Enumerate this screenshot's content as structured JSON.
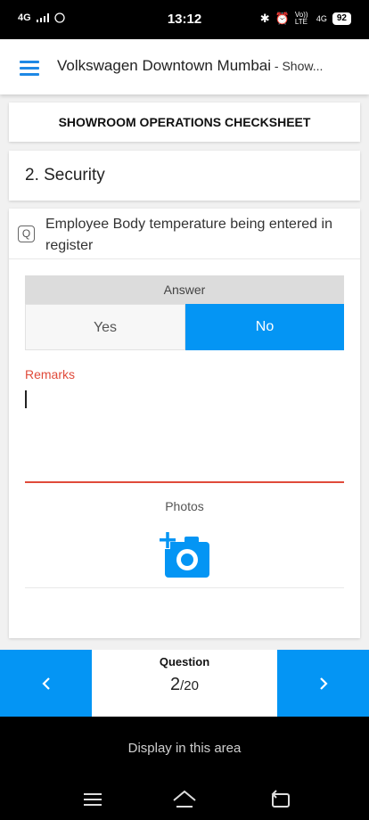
{
  "status_bar": {
    "network": "4G",
    "time": "13:12",
    "right_icons": [
      "bluetooth-icon",
      "alarm-icon",
      "volte-icon",
      "signal-4g-icon"
    ],
    "volte": "Vo)) LTE",
    "net_right": "4G",
    "battery": "92"
  },
  "header": {
    "title": "Volkswagen Downtown Mumbai",
    "subtitle": " - Show...",
    "menu_icon": "hamburger-menu-icon",
    "accent": "#1e88e5"
  },
  "checksheet": {
    "title": "SHOWROOM OPERATIONS CHECKSHEET"
  },
  "section": {
    "title": "2. Security"
  },
  "question": {
    "icon_glyph": "Q",
    "text": "Employee Body temperature being entered in register",
    "answer": {
      "header": "Answer",
      "options": [
        "Yes",
        "No"
      ],
      "selected": "No",
      "selected_color": "#0495f4"
    },
    "remarks": {
      "label": "Remarks",
      "value": "",
      "accent": "#e04a3a"
    },
    "photos": {
      "label": "Photos",
      "icon": "add-photo-camera-icon"
    }
  },
  "navigator": {
    "label": "Question",
    "current": "2",
    "total": "/20",
    "prev_icon": "chevron-left-icon",
    "next_icon": "chevron-right-icon",
    "color": "#0495f4"
  },
  "bottom": {
    "display_text": "Display in this area",
    "system_nav": [
      "menu-icon",
      "home-icon",
      "back-icon"
    ]
  }
}
